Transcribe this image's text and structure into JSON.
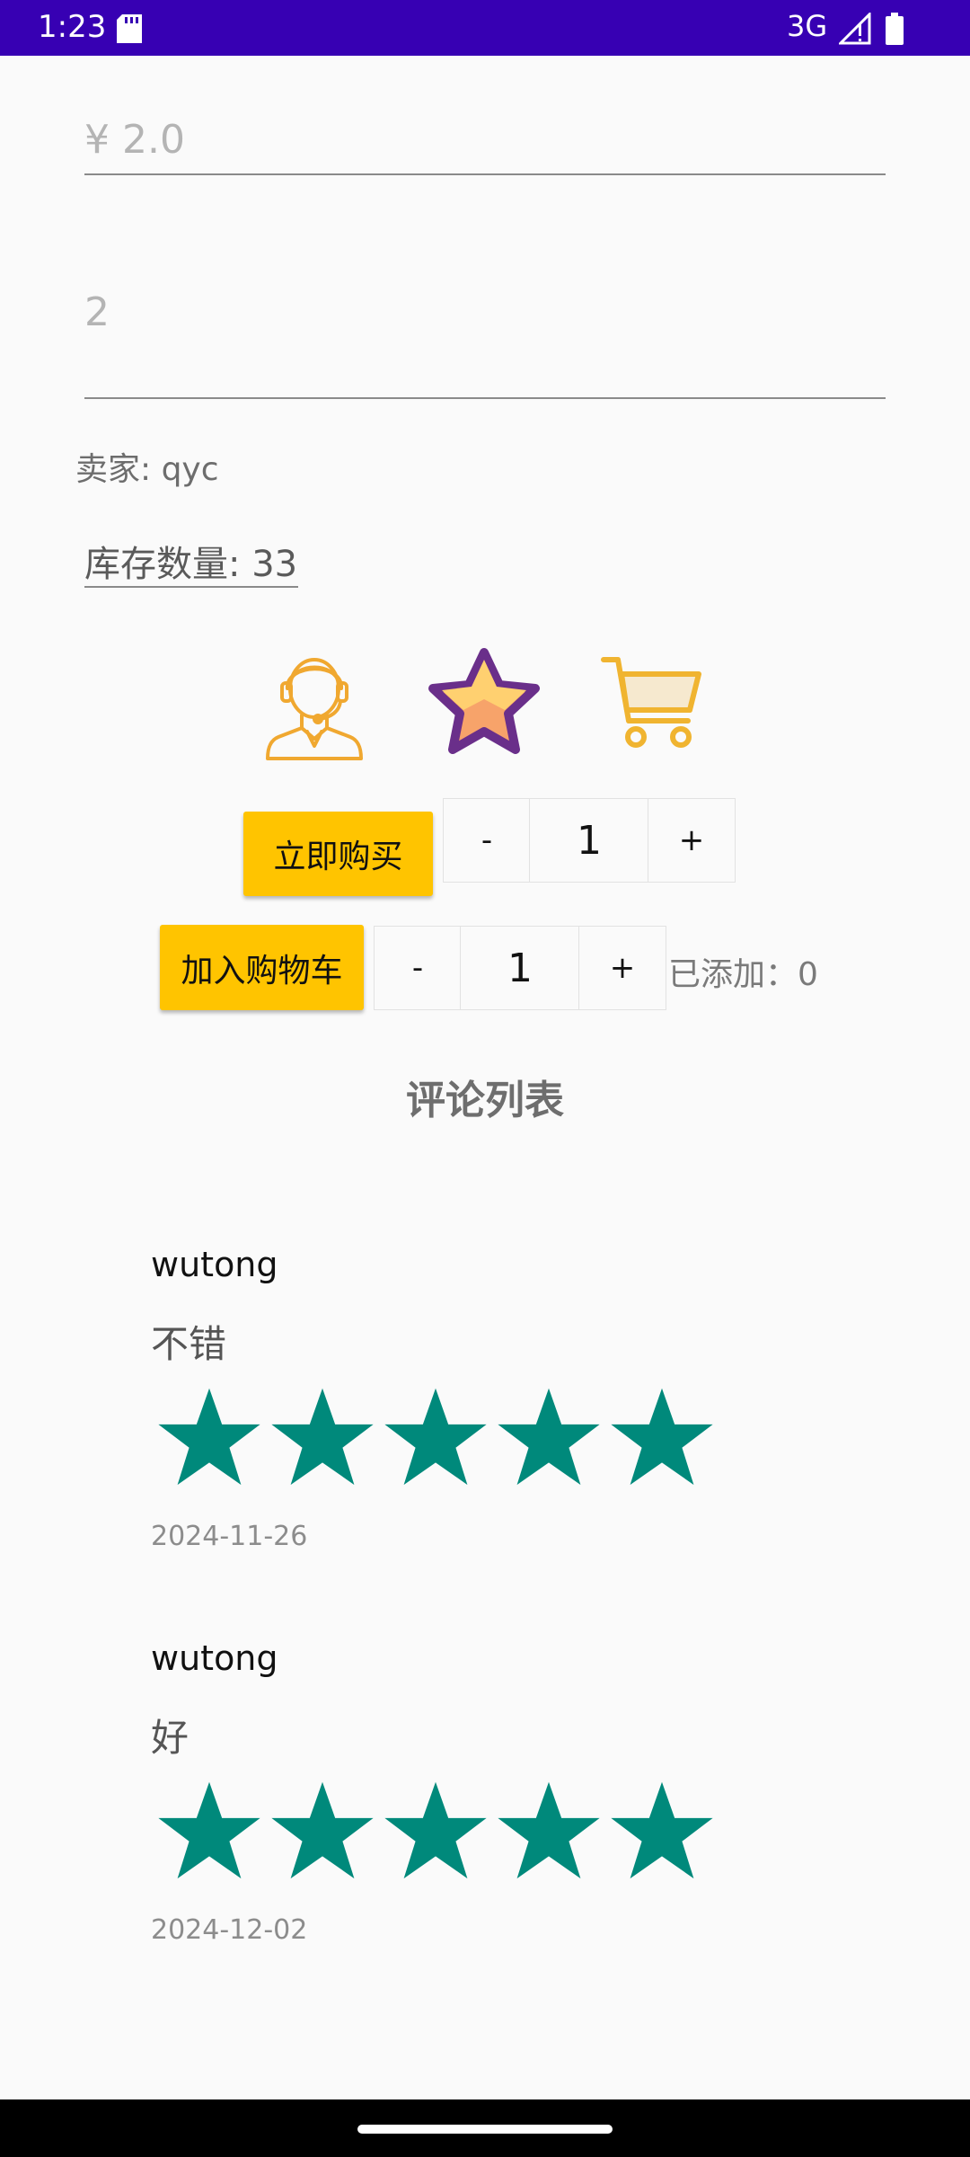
{
  "status_bar": {
    "time": "1:23",
    "network": "3G",
    "icons": [
      "sd-card-icon",
      "signal-icon",
      "battery-icon"
    ]
  },
  "product": {
    "price": "¥ 2.0",
    "quantity_field": "2",
    "seller": "卖家: qyc",
    "stock": "库存数量: 33"
  },
  "actions": {
    "icons": [
      "customer-service-icon",
      "favorite-star-icon",
      "shopping-cart-icon"
    ],
    "buy_now_label": "立即购买",
    "add_to_cart_label": "加入购物车",
    "minus": "-",
    "plus": "+",
    "buy_qty": "1",
    "cart_qty": "1",
    "added_text": "已添加：0"
  },
  "comments": {
    "title": "评论列表",
    "items": [
      {
        "user": "wutong",
        "content": "不错",
        "rating": 5,
        "date": "2024-11-26"
      },
      {
        "user": "wutong",
        "content": "好",
        "rating": 5,
        "date": "2024-12-02"
      }
    ]
  },
  "colors": {
    "status_bar": "#3700b3",
    "button": "#ffc400",
    "star": "#00897b",
    "icon_orange": "#f0a830",
    "icon_purple": "#6a2f8a"
  }
}
